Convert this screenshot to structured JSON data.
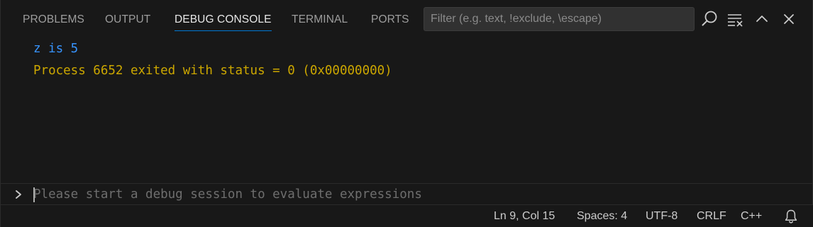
{
  "tabs": [
    {
      "label": "PROBLEMS",
      "active": false
    },
    {
      "label": "OUTPUT",
      "active": false
    },
    {
      "label": "DEBUG CONSOLE",
      "active": true
    },
    {
      "label": "TERMINAL",
      "active": false
    },
    {
      "label": "PORTS",
      "active": false
    }
  ],
  "filter": {
    "placeholder": "Filter (e.g. text, !exclude, \\escape)",
    "value": ""
  },
  "toolbar_icons": [
    "search-icon",
    "clear-console-icon",
    "chevron-up-icon",
    "close-icon"
  ],
  "console": {
    "lines": [
      {
        "text": "z is 5",
        "kind": "info"
      },
      {
        "text": "Process 6652 exited with status = 0 (0x00000000)",
        "kind": "warn"
      }
    ]
  },
  "repl": {
    "placeholder": "Please start a debug session to evaluate expressions",
    "value": ""
  },
  "status": {
    "position": "Ln 9, Col 15",
    "indent": "Spaces: 4",
    "encoding": "UTF-8",
    "eol": "CRLF",
    "language": "C++"
  },
  "colors": {
    "background": "#181818",
    "active_tab_underline": "#0078d4",
    "info_text": "#3794ff",
    "warn_text": "#cca700"
  }
}
